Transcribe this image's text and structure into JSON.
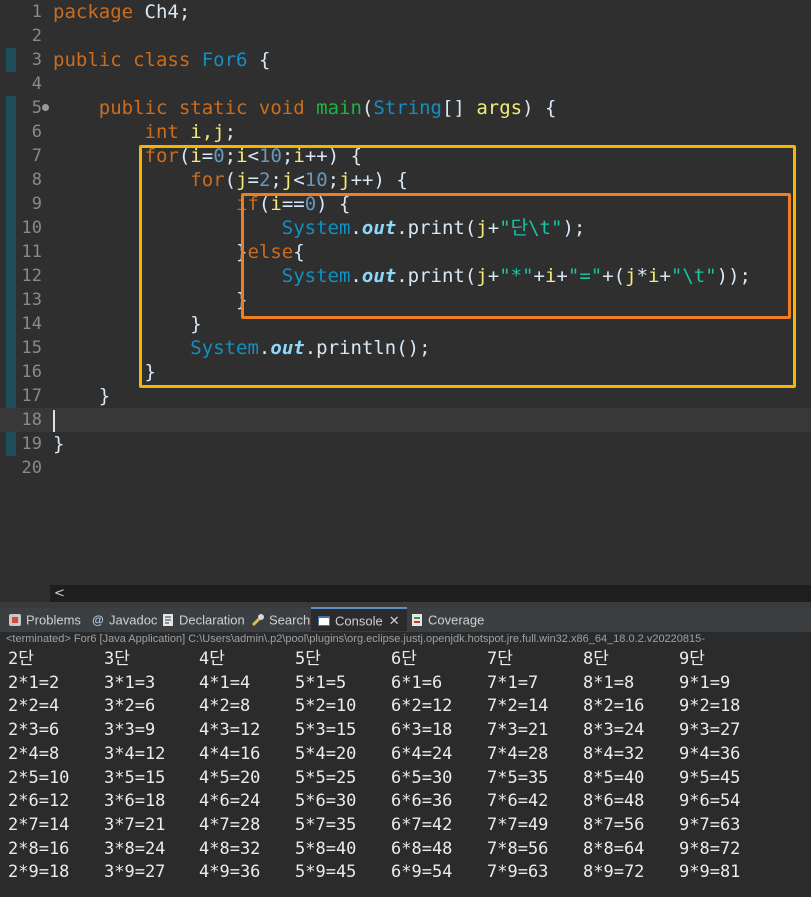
{
  "editor": {
    "line_numbers": [
      "1",
      "2",
      "3",
      "4",
      "5",
      "6",
      "7",
      "8",
      "9",
      "10",
      "11",
      "12",
      "13",
      "14",
      "15",
      "16",
      "17",
      "18",
      "19",
      "20"
    ],
    "code": {
      "l1_kw": "package",
      "l1_rest": " Ch4;",
      "l3_kw": "public class",
      "l3_cls": "For6",
      "l3_rest": " {",
      "l5_indent": "    ",
      "l5_kw": "public static void",
      "l5_fn": "main",
      "l5_p1": "(",
      "l5_cls": "String",
      "l5_p2": "[] ",
      "l5_arg": "args",
      "l5_p3": ") {",
      "l6_indent": "        ",
      "l6_kw": "int",
      "l6_sp": " ",
      "l6_vars": "i,j",
      "l6_end": ";",
      "l7_indent": "        ",
      "l7_kw": "for",
      "l7_p1": "(",
      "l7_i1": "i",
      "l7_eq": "=",
      "l7_n0": "0",
      "l7_s1": ";",
      "l7_i2": "i",
      "l7_lt": "<",
      "l7_n10": "10",
      "l7_s2": ";",
      "l7_i3": "i",
      "l7_inc": "++) {",
      "l8_indent": "            ",
      "l8_kw": "for",
      "l8_p1": "(",
      "l8_j1": "j",
      "l8_eq": "=",
      "l8_n2": "2",
      "l8_s1": ";",
      "l8_j2": "j",
      "l8_lt": "<",
      "l8_n10": "10",
      "l8_s2": ";",
      "l8_j3": "j",
      "l8_inc": "++) {",
      "l9_indent": "                ",
      "l9_kw": "if",
      "l9_p1": "(",
      "l9_i": "i",
      "l9_eq": "==",
      "l9_n0": "0",
      "l9_p2": ") {",
      "l10_indent": "                    ",
      "l10_cls": "System",
      "l10_dot": ".",
      "l10_out": "out",
      "l10_print": ".print(",
      "l10_j": "j",
      "l10_plus": "+",
      "l10_str": "\"단\\t\"",
      "l10_end": ");",
      "l11_indent": "                ",
      "l11_brace": "}",
      "l11_kw": "else",
      "l11_brace2": "{",
      "l12_indent": "                    ",
      "l12_cls": "System",
      "l12_dot": ".",
      "l12_out": "out",
      "l12_print": ".print(",
      "l12_j1": "j",
      "l12_plus1": "+",
      "l12_str1": "\"*\"",
      "l12_plus2": "+",
      "l12_i1": "i",
      "l12_plus3": "+",
      "l12_str2": "\"=\"",
      "l12_plus4": "+(",
      "l12_j2": "j",
      "l12_mul": "*",
      "l12_i2": "i",
      "l12_plus5": "+",
      "l12_str3": "\"\\t\"",
      "l12_end": "));",
      "l13_indent": "                ",
      "l13_brace": "}",
      "l14_indent": "            ",
      "l14_brace": "}",
      "l15_indent": "            ",
      "l15_cls": "System",
      "l15_dot": ".",
      "l15_out": "out",
      "l15_rest": ".println();",
      "l16_indent": "        ",
      "l16_brace": "}",
      "l17_indent": "    ",
      "l17_brace": "}",
      "l19_brace": "}"
    }
  },
  "scrollbar": {
    "left_arrow": "<"
  },
  "tabs": [
    {
      "label": "Problems",
      "icon": "problems-icon"
    },
    {
      "label": "Javadoc",
      "icon": "javadoc-icon",
      "glyph": "@"
    },
    {
      "label": "Declaration",
      "icon": "declaration-icon"
    },
    {
      "label": "Search",
      "icon": "search-icon"
    },
    {
      "label": "Console",
      "icon": "console-icon",
      "active": true,
      "close": "✕"
    },
    {
      "label": "Coverage",
      "icon": "coverage-icon"
    }
  ],
  "console": {
    "status_line": "<terminated> For6 [Java Application] C:\\Users\\admin\\.p2\\pool\\plugins\\org.eclipse.justj.openjdk.hotspot.jre.full.win32.x86_64_18.0.2.v20220815-",
    "rows": [
      [
        "2단",
        "3단",
        "4단",
        "5단",
        "6단",
        "7단",
        "8단",
        "9단"
      ],
      [
        "2*1=2",
        "3*1=3",
        "4*1=4",
        "5*1=5",
        "6*1=6",
        "7*1=7",
        "8*1=8",
        "9*1=9"
      ],
      [
        "2*2=4",
        "3*2=6",
        "4*2=8",
        "5*2=10",
        "6*2=12",
        "7*2=14",
        "8*2=16",
        "9*2=18"
      ],
      [
        "2*3=6",
        "3*3=9",
        "4*3=12",
        "5*3=15",
        "6*3=18",
        "7*3=21",
        "8*3=24",
        "9*3=27"
      ],
      [
        "2*4=8",
        "3*4=12",
        "4*4=16",
        "5*4=20",
        "6*4=24",
        "7*4=28",
        "8*4=32",
        "9*4=36"
      ],
      [
        "2*5=10",
        "3*5=15",
        "4*5=20",
        "5*5=25",
        "6*5=30",
        "7*5=35",
        "8*5=40",
        "9*5=45"
      ],
      [
        "2*6=12",
        "3*6=18",
        "4*6=24",
        "5*6=30",
        "6*6=36",
        "7*6=42",
        "8*6=48",
        "9*6=54"
      ],
      [
        "2*7=14",
        "3*7=21",
        "4*7=28",
        "5*7=35",
        "6*7=42",
        "7*7=49",
        "8*7=56",
        "9*7=63"
      ],
      [
        "2*8=16",
        "3*8=24",
        "4*8=32",
        "5*8=40",
        "6*8=48",
        "7*8=56",
        "8*8=64",
        "9*8=72"
      ],
      [
        "2*9=18",
        "3*9=27",
        "4*9=36",
        "5*9=45",
        "6*9=54",
        "7*9=63",
        "8*9=72",
        "9*9=81"
      ]
    ]
  },
  "colors": {
    "highlight_outer": "#f5b400",
    "highlight_inner": "#f07d1f"
  }
}
